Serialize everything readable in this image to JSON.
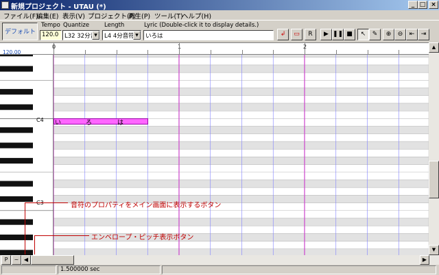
{
  "window": {
    "title": "新規プロジェクト - UTAU (*)",
    "minimize": "_",
    "maximize": "□",
    "close": "×"
  },
  "menu": [
    "ファイル(F)",
    "編集(E)",
    "表示(V)",
    "プロジェクト(P)",
    "再生(P)",
    "ツール(T)",
    "ヘルプ(H)"
  ],
  "toolbar": {
    "selected_voice": "デフォルト",
    "tempo_label": "Tempo",
    "tempo_value": "120.0",
    "quantize_label": "Quantize",
    "quantize_value": "L32 32分音",
    "length_label": "Length",
    "length_value": "L4  4分音符",
    "lyric_label": "Lyric (Double-click it to display details.)",
    "lyric_value": "いろは"
  },
  "ruler": {
    "tempo": "120.00",
    "measures": [
      "0",
      "1",
      "2"
    ]
  },
  "roll": {
    "c4_label": "C4",
    "c3_label": "C3",
    "note_lyrics": [
      "い",
      "ろ",
      "は"
    ]
  },
  "annotations": {
    "properties_button": "音符のプロパティをメイン画面に表示するボタン",
    "envelope_button": "エンベロープ・ピッチ表示ボタン"
  },
  "bottom": {
    "properties_btn": "P",
    "envelope_btn": "~",
    "time": "1.500000 sec"
  },
  "colors": {
    "note_fill": "#ff66ff",
    "annotation": "#c00000",
    "measure_line": "#cc44cc",
    "beat_line": "#8080ff"
  }
}
